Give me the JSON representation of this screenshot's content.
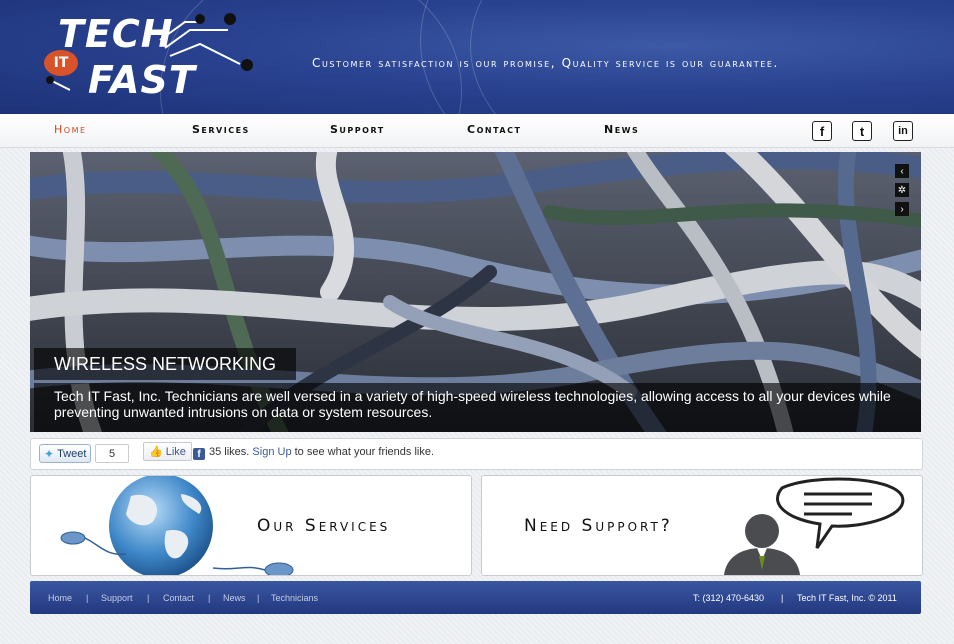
{
  "header": {
    "logo": {
      "word1": "TECH",
      "badge": "IT",
      "word2": "FAST"
    },
    "tagline": "Customer satisfaction is our promise, Quality service is our guarantee."
  },
  "nav": {
    "items": [
      {
        "label": "Home",
        "active": true
      },
      {
        "label": "Services",
        "active": false
      },
      {
        "label": "Support",
        "active": false
      },
      {
        "label": "Contact",
        "active": false
      },
      {
        "label": "News",
        "active": false
      }
    ],
    "social": [
      {
        "icon": "facebook-icon",
        "glyph": "f"
      },
      {
        "icon": "twitter-icon",
        "glyph": "t"
      },
      {
        "icon": "linkedin-icon",
        "glyph": "in"
      }
    ]
  },
  "hero": {
    "caption_title": "WIRELESS NETWORKING",
    "caption_body": "Tech IT Fast, Inc. Technicians are well versed in a variety of high-speed wireless technologies, allowing access to all your devices while preventing unwanted intrusions on data or system resources.",
    "controls": {
      "prev": "‹",
      "loading": "✲",
      "next": "›"
    }
  },
  "social_bar": {
    "tweet_label": "Tweet",
    "tweet_count": "5",
    "like_label": "Like",
    "fb_likes": "35 likes.",
    "signup_link": "Sign Up",
    "fb_suffix": "to see what your friends like."
  },
  "boxes": {
    "services": "Our Services",
    "support": "Need Support?"
  },
  "footer": {
    "links": [
      "Home",
      "Support",
      "Contact",
      "News",
      "Technicians"
    ],
    "phone": "T: (312) 470-6430",
    "copyright": "Tech IT Fast, Inc. © 2011"
  },
  "colors": {
    "header_blue": "#2a4391",
    "nav_active": "#cc4a1f",
    "logo_badge": "#d9532a",
    "footer_blue": "#2b4490"
  }
}
